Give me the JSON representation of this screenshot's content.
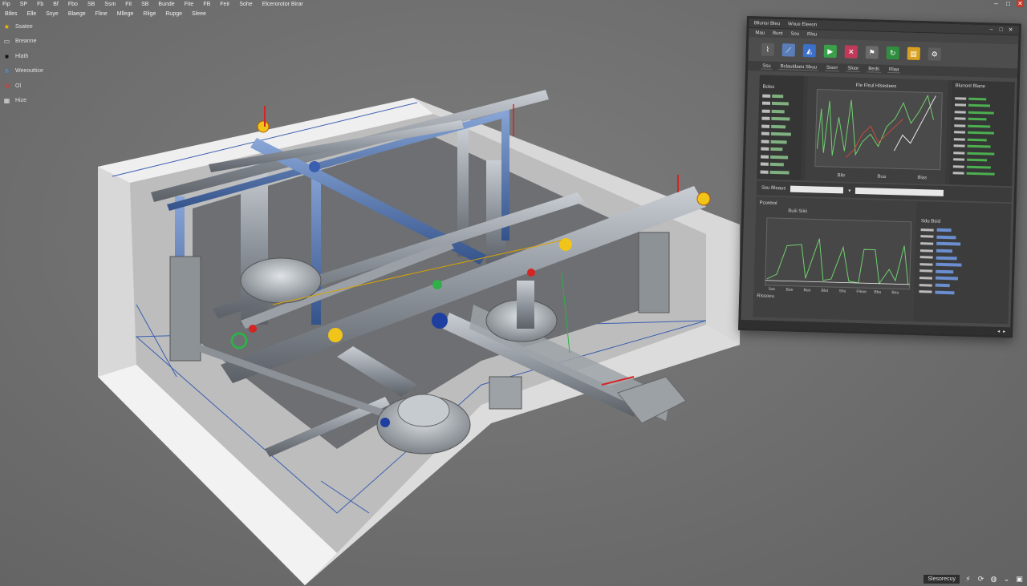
{
  "menu": {
    "items": [
      "Fip",
      "SP",
      "Fb",
      "Bf",
      "Fbo",
      "SB",
      "Ssm",
      "Fit",
      "SB",
      "Bunde",
      "Fite",
      "FB",
      "Feir",
      "Sohe",
      "Elcerorotor Birar"
    ]
  },
  "second_menu": {
    "items": [
      "Btles",
      "Elle",
      "Ssye",
      "Blaege",
      "Fline",
      "Mllege",
      "Rlige",
      "Rupge",
      "Sleee"
    ]
  },
  "tools": [
    {
      "label": "Ssatee",
      "icon": "star-icon",
      "color": "#f2c200"
    },
    {
      "label": "Breanne",
      "icon": "box-icon",
      "color": "#e0e0e0"
    },
    {
      "label": "Hlath",
      "icon": "square-icon",
      "color": "#111111"
    },
    {
      "label": "Weeouttice",
      "icon": "network-icon",
      "color": "#5a8fd8"
    },
    {
      "label": "Ol",
      "icon": "gear-icon",
      "color": "#d83a3a"
    },
    {
      "label": "Hize",
      "icon": "grid-icon",
      "color": "#e0e0e0"
    }
  ],
  "panel": {
    "title": "Bllunor Bleu",
    "title_extra": "Wnue   Eleeon",
    "menu": [
      "Mau",
      "Bunt",
      "Sou",
      "Rlsu"
    ],
    "tabs": [
      "Ssu",
      "Bclauidaeu Sbuu",
      "Ssorr",
      "Sloor",
      "Beds",
      "Rlaa"
    ],
    "chart1_title": "Fle Flsul Hlsestees",
    "chart1_x_labels": [
      "Blle",
      "Bua",
      "Blas"
    ],
    "right_header": "Blunont Blane",
    "side_header": "Bolss",
    "mid_label": "Ssu Bleaus",
    "lower_header": "Pcontrol",
    "lower_sub": "Buiii Siiiii",
    "chart2_x_labels": [
      "Sxe",
      "Bue",
      "Buu",
      "Blut",
      "Shu",
      "Fleue",
      "Bbu",
      "Beu"
    ],
    "chart2_footer": "Rissoeu",
    "list2_header": "Sdu Bsid"
  },
  "bottom": {
    "label": "Slesorecuy"
  },
  "colors": {
    "accent_green": "#4caf50",
    "pipe_blue": "#4a6fb0",
    "pipe_grey": "#8f959c",
    "valve_yellow": "#f0c419"
  }
}
